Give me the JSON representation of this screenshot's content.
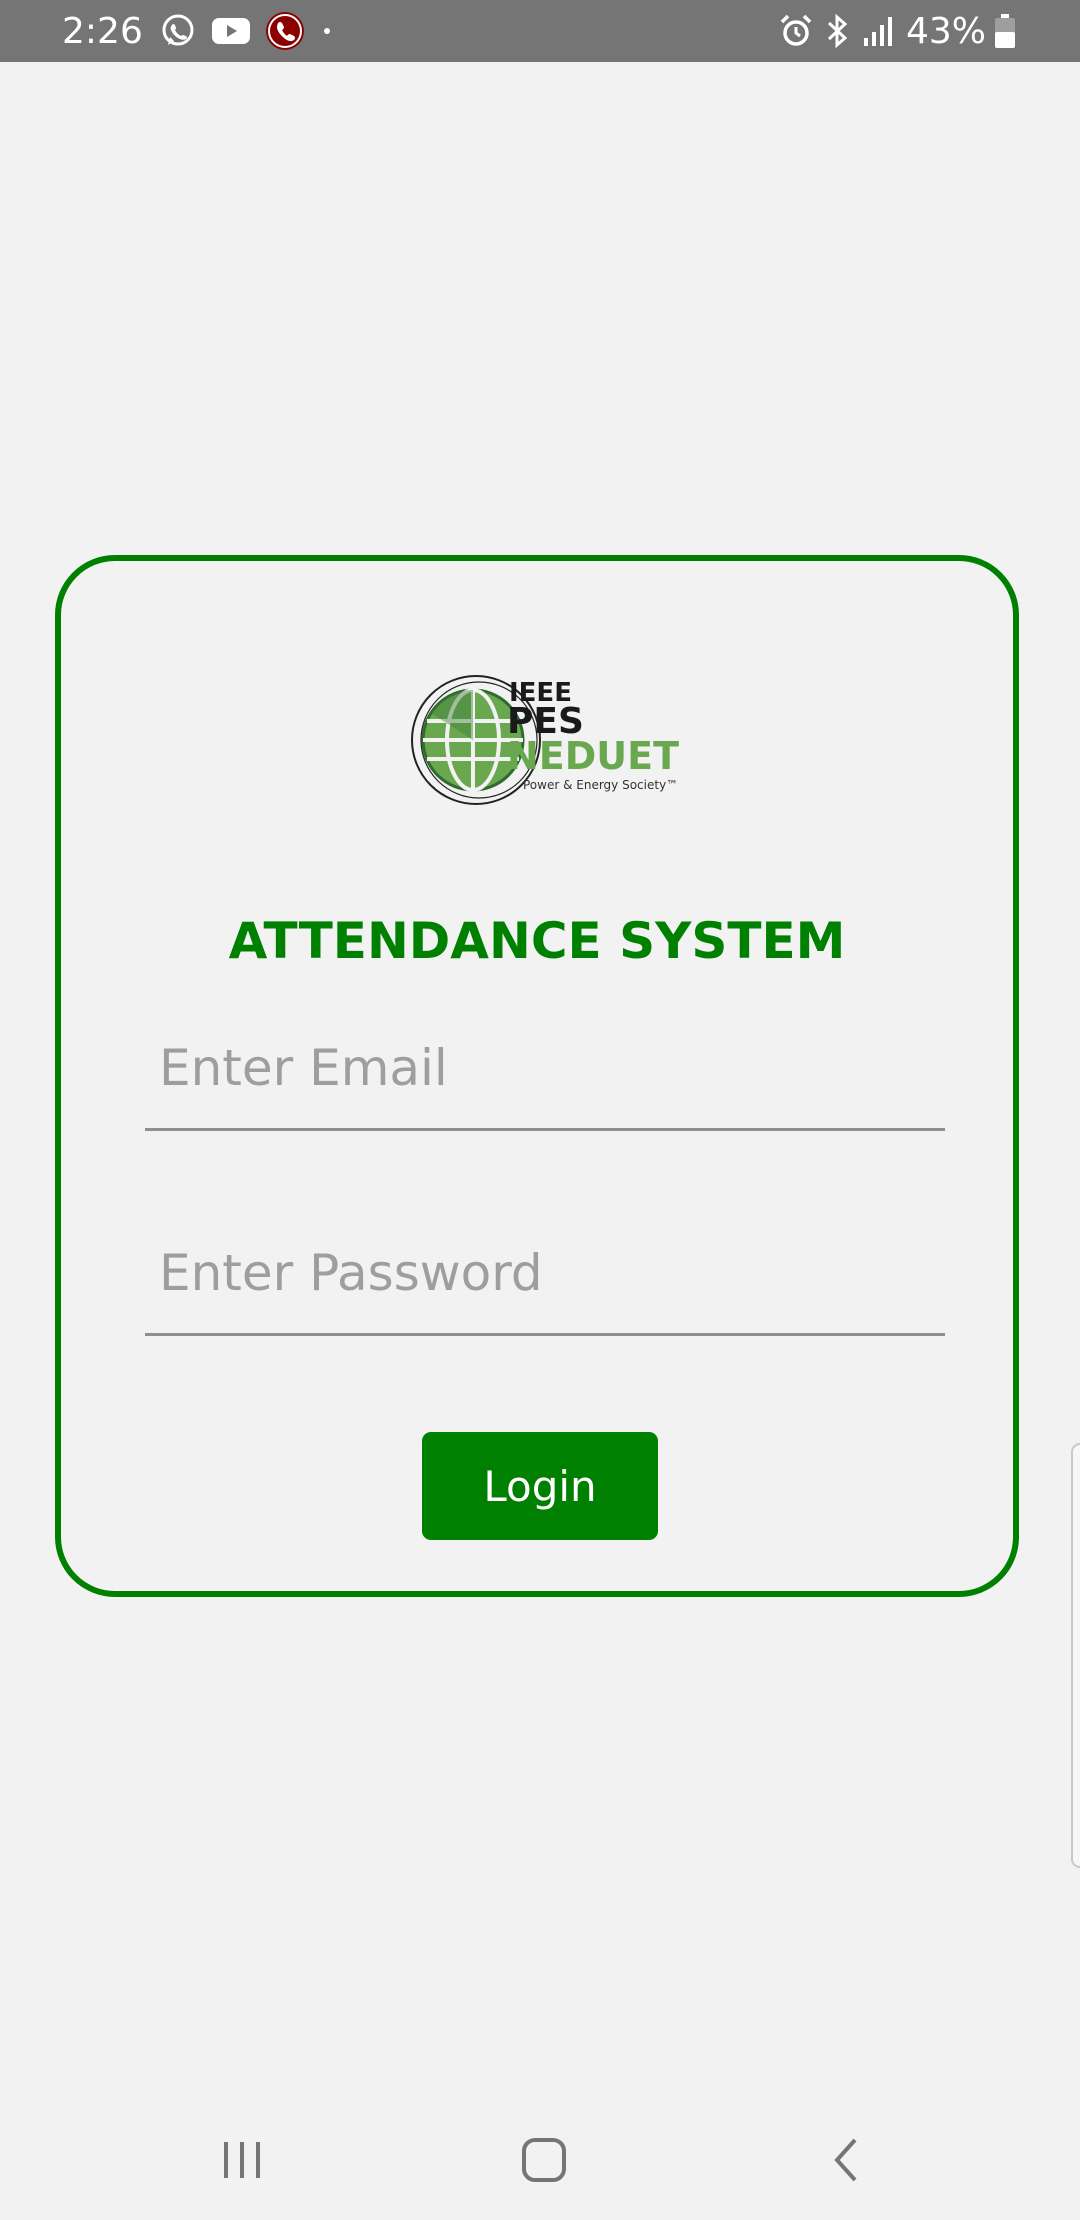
{
  "status_bar": {
    "time": "2:26",
    "left_icons": [
      "whatsapp-icon",
      "youtube-icon",
      "call-icon",
      "dot-icon"
    ],
    "right_icons": [
      "alarm-icon",
      "bluetooth-icon",
      "signal-icon",
      "battery-icon"
    ],
    "battery_percent": "43%"
  },
  "login": {
    "logo": {
      "line1": "IEEE",
      "line2": "PES",
      "line3": "NEDUET",
      "tagline": "Power & Energy Society™"
    },
    "title": "ATTENDANCE SYSTEM",
    "email_placeholder": "Enter Email",
    "email_value": "",
    "password_placeholder": "Enter Password",
    "password_value": "",
    "login_label": "Login"
  },
  "colors": {
    "accent": "#008000",
    "background": "#f2f2f2",
    "status_bar": "#757575",
    "logo_green": "#6aa84f"
  },
  "nav_bar": {
    "buttons": [
      "recents-icon",
      "home-icon",
      "back-icon"
    ]
  }
}
